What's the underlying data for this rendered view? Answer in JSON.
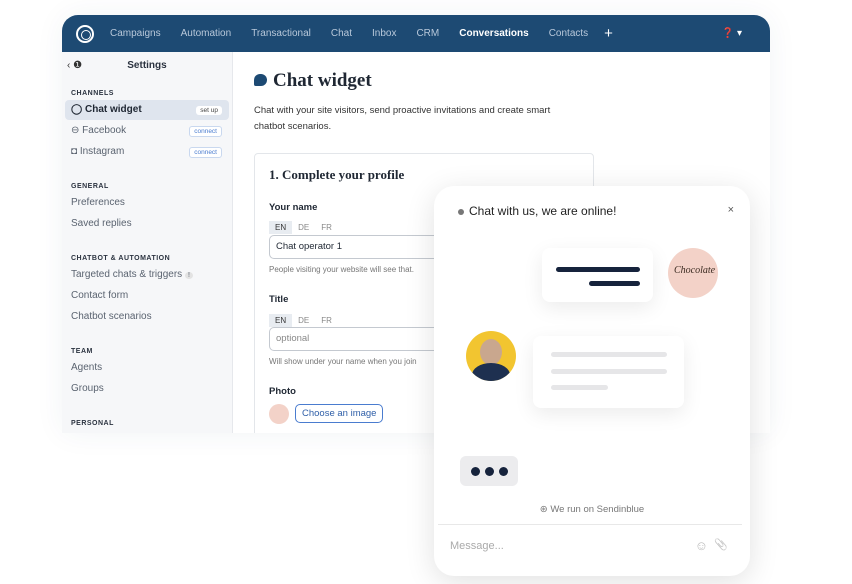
{
  "nav": {
    "items": [
      "Campaigns",
      "Automation",
      "Transactional",
      "Chat",
      "Inbox",
      "CRM",
      "Conversations",
      "Contacts"
    ],
    "active": "Conversations",
    "plus": "+",
    "help": "❓ ▾"
  },
  "sidebar": {
    "title": "Settings",
    "back": "‹ ❶",
    "sections": [
      {
        "title": "CHANNELS",
        "items": [
          {
            "label": "Chat widget",
            "badge": "set up",
            "icon": "chat-bubble-icon"
          },
          {
            "label": "Facebook",
            "badge": "connect",
            "icon": "messenger-icon"
          },
          {
            "label": "Instagram",
            "badge": "connect",
            "icon": "instagram-icon"
          }
        ]
      },
      {
        "title": "GENERAL",
        "items": [
          {
            "label": "Preferences"
          },
          {
            "label": "Saved replies"
          }
        ]
      },
      {
        "title": "CHATBOT & AUTOMATION",
        "items": [
          {
            "label": "Targeted chats & triggers",
            "info": "!"
          },
          {
            "label": "Contact form"
          },
          {
            "label": "Chatbot scenarios"
          }
        ]
      },
      {
        "title": "TEAM",
        "items": [
          {
            "label": "Agents"
          },
          {
            "label": "Groups"
          }
        ]
      },
      {
        "title": "PERSONAL",
        "items": []
      }
    ]
  },
  "main": {
    "title": "Chat widget",
    "description": "Chat with your site visitors, send proactive invitations and create smart chatbot scenarios.",
    "card": {
      "title": "1. Complete your profile",
      "name_label": "Your name",
      "langs": [
        "EN",
        "DE",
        "FR"
      ],
      "name_value": "Chat operator 1",
      "name_hint": "People visiting your website will see that.",
      "title_label": "Title",
      "title_placeholder": "optional",
      "title_hint": "Will show under your name when you join",
      "photo_label": "Photo",
      "choose_button": "Choose an image"
    }
  },
  "widget": {
    "header": "Chat with us, we are online!",
    "close": "×",
    "powered": "We run on Sendinblue",
    "message_placeholder": "Message...",
    "emoji": "☺",
    "attach": "📎",
    "colors": {
      "dark_bar": "#16233c",
      "avatar_yellow": "#f2c530",
      "avatar_pink": "#f3d2c8"
    }
  }
}
